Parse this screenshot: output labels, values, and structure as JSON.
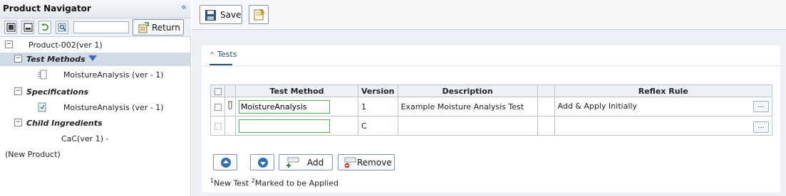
{
  "navigator": {
    "title": "Product Navigator",
    "collapse_glyph": "«",
    "return_label": "Return",
    "search_value": "",
    "tree": {
      "root": "Product-002(ver 1)",
      "test_methods": "Test Methods",
      "test_methods_child": "MoistureAnalysis (ver - 1)",
      "specifications": "Specifications",
      "specifications_child": "MoistureAnalysis (ver - 1)",
      "child_ingredients": "Child Ingredients",
      "child_ingredients_child": "CaC(ver 1) -",
      "new_product": "(New Product)"
    }
  },
  "toolbar": {
    "save_label": "Save"
  },
  "tests": {
    "tab_label": "Tests",
    "columns": [
      "",
      "",
      "Test Method",
      "Version",
      "Description",
      "",
      "Reflex Rule"
    ],
    "rows": [
      {
        "test_method": "MoistureAnalysis",
        "version": "1",
        "description": "Example Moisture Analysis Test",
        "reflex_rule": "Add & Apply Initially",
        "ellipsis": "..."
      },
      {
        "test_method": "",
        "version": "C",
        "description": "",
        "reflex_rule": "",
        "ellipsis": "..."
      }
    ],
    "add_label": "Add",
    "remove_label": "Remove",
    "legend_1_sup": "1",
    "legend_1": "New Test ",
    "legend_2_sup": "2",
    "legend_2": "Marked to be Applied"
  },
  "colors": {
    "accent": "#2a4d7a",
    "selection": "#d0dbe6",
    "valid_input_border": "#4caf50",
    "triangle": "#3e6bbf"
  },
  "icons": {
    "collapse": "double-chevron-left-icon",
    "expand_all": "expand-all-icon",
    "collapse_all": "collapse-all-icon",
    "refresh": "refresh-icon",
    "search": "search-icon",
    "return": "return-icon",
    "save": "floppy-disk-icon",
    "note": "note-icon",
    "move_up": "arrow-up-circle-icon",
    "move_down": "arrow-down-circle-icon",
    "add": "add-row-icon",
    "remove": "remove-row-icon",
    "test_tube": "test-tube-icon",
    "method": "method-icon",
    "spec": "spec-icon"
  }
}
